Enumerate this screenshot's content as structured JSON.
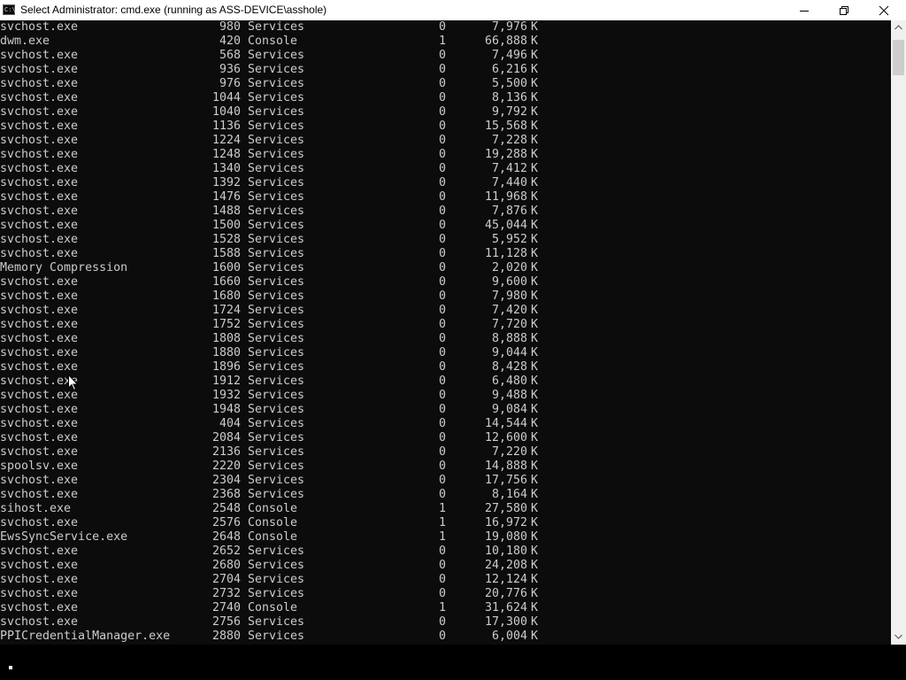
{
  "window": {
    "title": "Select Administrator: cmd.exe (running as ASS-DEVICE\\asshole)",
    "icon_name": "cmd-icon",
    "icon_text": "C:\\"
  },
  "rows": [
    {
      "name": "svchost.exe",
      "pid": "980",
      "session": "Services",
      "num": "0",
      "mem": "7,976",
      "unit": "K"
    },
    {
      "name": "dwm.exe",
      "pid": "420",
      "session": "Console",
      "num": "1",
      "mem": "66,888",
      "unit": "K"
    },
    {
      "name": "svchost.exe",
      "pid": "568",
      "session": "Services",
      "num": "0",
      "mem": "7,496",
      "unit": "K"
    },
    {
      "name": "svchost.exe",
      "pid": "936",
      "session": "Services",
      "num": "0",
      "mem": "6,216",
      "unit": "K"
    },
    {
      "name": "svchost.exe",
      "pid": "976",
      "session": "Services",
      "num": "0",
      "mem": "5,500",
      "unit": "K"
    },
    {
      "name": "svchost.exe",
      "pid": "1044",
      "session": "Services",
      "num": "0",
      "mem": "8,136",
      "unit": "K"
    },
    {
      "name": "svchost.exe",
      "pid": "1040",
      "session": "Services",
      "num": "0",
      "mem": "9,792",
      "unit": "K"
    },
    {
      "name": "svchost.exe",
      "pid": "1136",
      "session": "Services",
      "num": "0",
      "mem": "15,568",
      "unit": "K"
    },
    {
      "name": "svchost.exe",
      "pid": "1224",
      "session": "Services",
      "num": "0",
      "mem": "7,228",
      "unit": "K"
    },
    {
      "name": "svchost.exe",
      "pid": "1248",
      "session": "Services",
      "num": "0",
      "mem": "19,288",
      "unit": "K"
    },
    {
      "name": "svchost.exe",
      "pid": "1340",
      "session": "Services",
      "num": "0",
      "mem": "7,412",
      "unit": "K"
    },
    {
      "name": "svchost.exe",
      "pid": "1392",
      "session": "Services",
      "num": "0",
      "mem": "7,440",
      "unit": "K"
    },
    {
      "name": "svchost.exe",
      "pid": "1476",
      "session": "Services",
      "num": "0",
      "mem": "11,968",
      "unit": "K"
    },
    {
      "name": "svchost.exe",
      "pid": "1488",
      "session": "Services",
      "num": "0",
      "mem": "7,876",
      "unit": "K"
    },
    {
      "name": "svchost.exe",
      "pid": "1500",
      "session": "Services",
      "num": "0",
      "mem": "45,044",
      "unit": "K"
    },
    {
      "name": "svchost.exe",
      "pid": "1528",
      "session": "Services",
      "num": "0",
      "mem": "5,952",
      "unit": "K"
    },
    {
      "name": "svchost.exe",
      "pid": "1588",
      "session": "Services",
      "num": "0",
      "mem": "11,128",
      "unit": "K"
    },
    {
      "name": "Memory Compression",
      "pid": "1600",
      "session": "Services",
      "num": "0",
      "mem": "2,020",
      "unit": "K"
    },
    {
      "name": "svchost.exe",
      "pid": "1660",
      "session": "Services",
      "num": "0",
      "mem": "9,600",
      "unit": "K"
    },
    {
      "name": "svchost.exe",
      "pid": "1680",
      "session": "Services",
      "num": "0",
      "mem": "7,980",
      "unit": "K"
    },
    {
      "name": "svchost.exe",
      "pid": "1724",
      "session": "Services",
      "num": "0",
      "mem": "7,420",
      "unit": "K"
    },
    {
      "name": "svchost.exe",
      "pid": "1752",
      "session": "Services",
      "num": "0",
      "mem": "7,720",
      "unit": "K"
    },
    {
      "name": "svchost.exe",
      "pid": "1808",
      "session": "Services",
      "num": "0",
      "mem": "8,888",
      "unit": "K"
    },
    {
      "name": "svchost.exe",
      "pid": "1880",
      "session": "Services",
      "num": "0",
      "mem": "9,044",
      "unit": "K"
    },
    {
      "name": "svchost.exe",
      "pid": "1896",
      "session": "Services",
      "num": "0",
      "mem": "8,428",
      "unit": "K"
    },
    {
      "name": "svchost.exe",
      "pid": "1912",
      "session": "Services",
      "num": "0",
      "mem": "6,480",
      "unit": "K"
    },
    {
      "name": "svchost.exe",
      "pid": "1932",
      "session": "Services",
      "num": "0",
      "mem": "9,488",
      "unit": "K"
    },
    {
      "name": "svchost.exe",
      "pid": "1948",
      "session": "Services",
      "num": "0",
      "mem": "9,084",
      "unit": "K"
    },
    {
      "name": "svchost.exe",
      "pid": "404",
      "session": "Services",
      "num": "0",
      "mem": "14,544",
      "unit": "K"
    },
    {
      "name": "svchost.exe",
      "pid": "2084",
      "session": "Services",
      "num": "0",
      "mem": "12,600",
      "unit": "K"
    },
    {
      "name": "svchost.exe",
      "pid": "2136",
      "session": "Services",
      "num": "0",
      "mem": "7,220",
      "unit": "K"
    },
    {
      "name": "spoolsv.exe",
      "pid": "2220",
      "session": "Services",
      "num": "0",
      "mem": "14,888",
      "unit": "K"
    },
    {
      "name": "svchost.exe",
      "pid": "2304",
      "session": "Services",
      "num": "0",
      "mem": "17,756",
      "unit": "K"
    },
    {
      "name": "svchost.exe",
      "pid": "2368",
      "session": "Services",
      "num": "0",
      "mem": "8,164",
      "unit": "K"
    },
    {
      "name": "sihost.exe",
      "pid": "2548",
      "session": "Console",
      "num": "1",
      "mem": "27,580",
      "unit": "K"
    },
    {
      "name": "svchost.exe",
      "pid": "2576",
      "session": "Console",
      "num": "1",
      "mem": "16,972",
      "unit": "K"
    },
    {
      "name": "EwsSyncService.exe",
      "pid": "2648",
      "session": "Console",
      "num": "1",
      "mem": "19,080",
      "unit": "K"
    },
    {
      "name": "svchost.exe",
      "pid": "2652",
      "session": "Services",
      "num": "0",
      "mem": "10,180",
      "unit": "K"
    },
    {
      "name": "svchost.exe",
      "pid": "2680",
      "session": "Services",
      "num": "0",
      "mem": "24,208",
      "unit": "K"
    },
    {
      "name": "svchost.exe",
      "pid": "2704",
      "session": "Services",
      "num": "0",
      "mem": "12,124",
      "unit": "K"
    },
    {
      "name": "svchost.exe",
      "pid": "2732",
      "session": "Services",
      "num": "0",
      "mem": "20,776",
      "unit": "K"
    },
    {
      "name": "svchost.exe",
      "pid": "2740",
      "session": "Console",
      "num": "1",
      "mem": "31,624",
      "unit": "K"
    },
    {
      "name": "svchost.exe",
      "pid": "2756",
      "session": "Services",
      "num": "0",
      "mem": "17,300",
      "unit": "K"
    },
    {
      "name": "PPICredentialManager.exe",
      "pid": "2880",
      "session": "Services",
      "num": "0",
      "mem": "6,004",
      "unit": "K"
    }
  ],
  "colors": {
    "console_bg": "#0c0c0c",
    "console_text": "#cccccc",
    "titlebar_bg": "#ffffff",
    "scrollbar_bg": "#f0f0f0",
    "scrollbar_thumb": "#cdcdcd"
  }
}
